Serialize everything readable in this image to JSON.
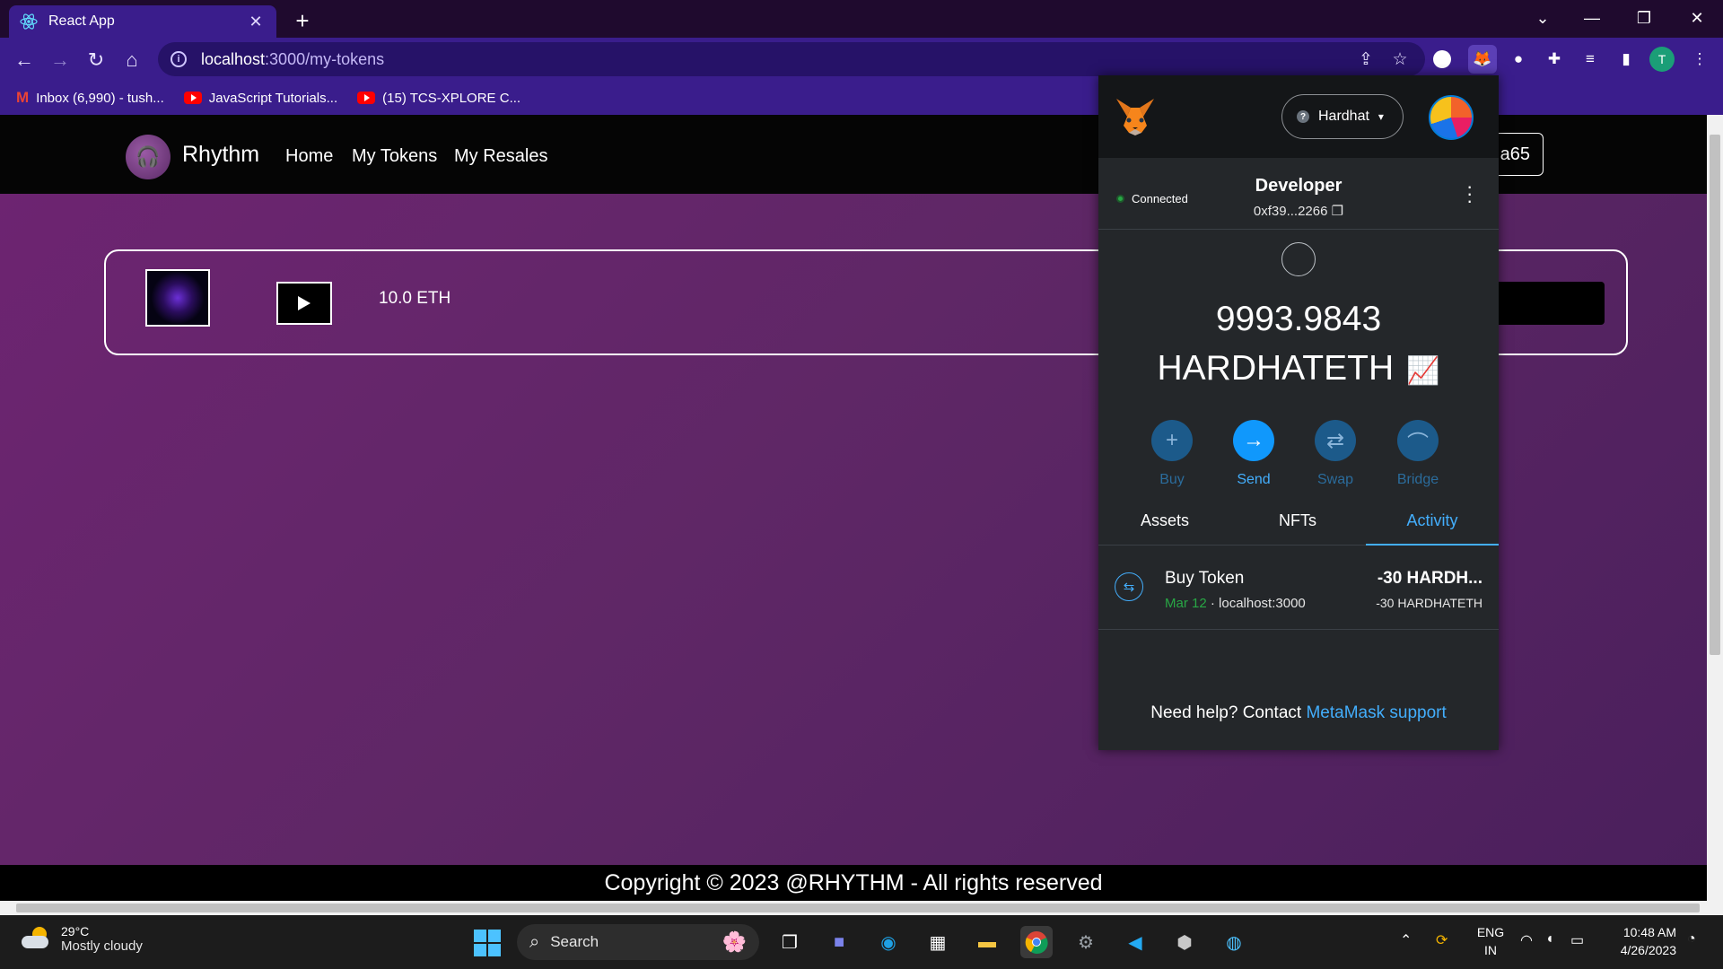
{
  "browser": {
    "tab_title": "React App",
    "tab_close": "✕",
    "new_tab": "+",
    "url_host": "localhost",
    "url_path": ":3000/my-tokens",
    "bookmarks": [
      {
        "label": "Inbox (6,990) - tush...",
        "icon": "gmail-icon"
      },
      {
        "label": "JavaScript Tutorials...",
        "icon": "youtube-icon"
      },
      {
        "label": "(15) TCS-XPLORE C...",
        "icon": "youtube-icon"
      }
    ],
    "profile_initial": "T"
  },
  "app": {
    "brand": "Rhythm",
    "nav": [
      "Home",
      "My Tokens",
      "My Resales"
    ],
    "account_button": "a65",
    "token": {
      "price": "10.0 ETH"
    },
    "footer": "Copyright © 2023 @RHYTHM - All rights reserved"
  },
  "metamask": {
    "network": "Hardhat",
    "network_icon": "?",
    "status": "Connected",
    "account_name": "Developer",
    "account_address": "0xf39...2266",
    "balance_amount": "9993.9843",
    "balance_symbol": "HARDHATETH",
    "actions": [
      "Buy",
      "Send",
      "Swap",
      "Bridge"
    ],
    "tabs": [
      "Assets",
      "NFTs",
      "Activity"
    ],
    "activity": [
      {
        "title": "Buy Token",
        "date": "Mar 12",
        "origin": " · localhost:3000",
        "amount": "-30 HARDH...",
        "amount_full": "-30 HARDHATETH"
      }
    ],
    "help_text": "Need help? Contact ",
    "help_link": "MetaMask support",
    "accent_color": "#43aefc"
  },
  "taskbar": {
    "temperature": "29°C",
    "weather": "Mostly cloudy",
    "search_label": "Search",
    "lang_1": "ENG",
    "lang_2": "IN",
    "time": "10:48 AM",
    "date": "4/26/2023"
  }
}
